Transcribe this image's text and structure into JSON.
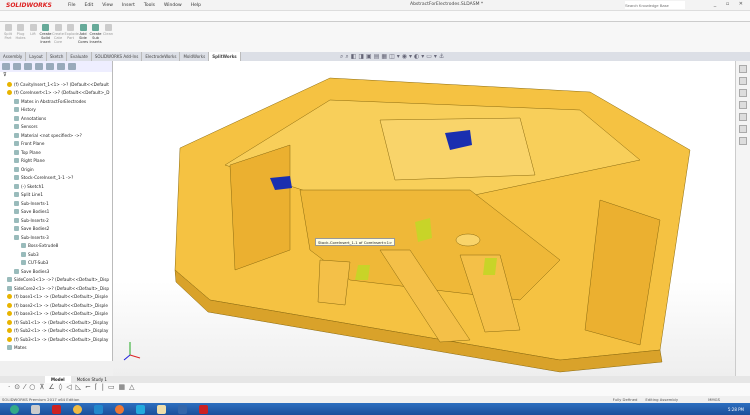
{
  "app": {
    "name": "SOLIDWORKS",
    "document_title": "AbstractForElectrodes.SLDASM *",
    "search_placeholder": "Search Knowledge Base"
  },
  "menu": [
    "File",
    "Edit",
    "View",
    "Insert",
    "Tools",
    "Window",
    "Help"
  ],
  "command_manager": [
    {
      "label": "Split Part",
      "enabled": false
    },
    {
      "label": "Plug Holes",
      "enabled": false
    },
    {
      "label": "Lift",
      "enabled": false
    },
    {
      "label": "Create Solid Insert",
      "enabled": true
    },
    {
      "label": "Create Cate Core",
      "enabled": false
    },
    {
      "label": "Explode Part",
      "enabled": false
    },
    {
      "label": "Add Side Cores",
      "enabled": true
    },
    {
      "label": "Create Sub Inserts",
      "enabled": true
    },
    {
      "label": "Clean",
      "enabled": false
    }
  ],
  "tabs": [
    "Assembly",
    "Layout",
    "Sketch",
    "Evaluate",
    "SOLIDWORKS Add-Ins",
    "ElectrodeWorks",
    "MoldWorks",
    "SplitWorks"
  ],
  "active_tab": "SplitWorks",
  "tree": [
    "(f) CavityInsert_1<1> ->? (Default<<Default",
    "(f) CoreInsert<1> ->? (Default<<Default>_D",
    "Mates in AbstractForElectrodes",
    "History",
    "Annotations",
    "Sensors",
    "Material <not specified> ->?",
    "Front Plane",
    "Top Plane",
    "Right Plane",
    "Origin",
    "Stock-CoreInsert_1-1 ->?",
    "(-) Sketch1",
    "Split Line1",
    "Sub-Inserts-1",
    "Save Bodies1",
    "Sub-Inserts-2",
    "Save Bodies2",
    "Sub-Inserts-3",
    "Boss-Extrude8",
    "Sub3",
    "CUT-Sub3",
    "Save Bodies3",
    "SideCore1<1> ->? (Default<<Default>_Disp",
    "SideCore2<1> ->? (Default<<Default>_Disp",
    "(f) base1<1> -> (Default<<Default>_Disple",
    "(f) base2<1> -> (Default<<Default>_Disple",
    "(f) base3<1> -> (Default<<Default>_Disple",
    "(f) Sub1<1> -> (Default<<Default>_Display",
    "(f) Sub2<1> -> (Default<<Default>_Display",
    "(f) Sub3<1> -> (Default<<Default>_Display",
    "Mates"
  ],
  "tooltip": "Stock-CoreInsert_1-1 of CoreInsert<1>",
  "bottom_tabs": [
    "Model",
    "Motion Study 1"
  ],
  "status": {
    "product": "SOLIDWORKS Premium 2017 x64 Edition",
    "sketch": "Fully Defined",
    "mode": "Editing Assembly",
    "units": "MMGS"
  },
  "clock": {
    "time": "5:28 PM"
  },
  "colors": {
    "part": "#f5c242",
    "insert": "#1a2fb0",
    "sidecore": "#c8d428",
    "taskbar": "#1f5aa8"
  }
}
